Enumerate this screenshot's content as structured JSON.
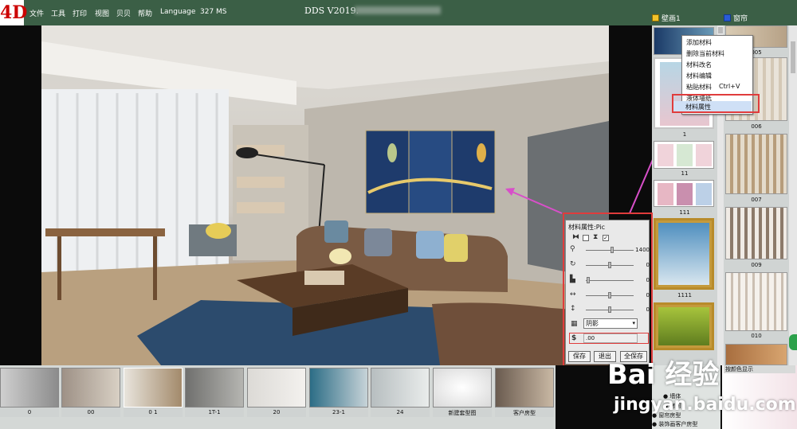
{
  "app": {
    "logo": "4D",
    "title": "DDS   V2019.",
    "menu": [
      "文件",
      "工具",
      "打印",
      "视图",
      "贝贝",
      "帮助",
      "Language",
      "327 MS"
    ],
    "window_tabs": [
      {
        "label": "壁画1",
        "icon": "picture-icon"
      },
      {
        "label": "窗帘",
        "icon": "home-icon"
      }
    ],
    "accent_colors": {
      "menubar": "#3b5f46",
      "highlight_box": "#e03c3c",
      "arrow": "#d84fc9"
    }
  },
  "context_menu": {
    "items": [
      "添加材料",
      "删除当前材料",
      "材料改名",
      "材料编辑",
      "粘贴材料",
      "液体墙纸",
      "材料属性"
    ],
    "paste_shortcut": "Ctrl+V",
    "selected": "材料属性"
  },
  "library_left": {
    "labels": [
      "1",
      "11",
      "111",
      "1111"
    ]
  },
  "library_right": {
    "labels": [
      "005",
      "006",
      "007",
      "009",
      "010"
    ]
  },
  "property_dialog": {
    "title": "材料属性:Pic",
    "checkbox_checked": true,
    "sliders": [
      {
        "name": "zoom",
        "icon": "zoom-icon",
        "value": "1400",
        "level": 0.55
      },
      {
        "name": "rotate",
        "icon": "rotate-icon",
        "value": "0",
        "level": 0.5
      },
      {
        "name": "shade",
        "icon": "shade-icon",
        "value": "0",
        "level": 0.02
      },
      {
        "name": "horizontal",
        "icon": "horizontal-arrows-icon",
        "value": "0",
        "level": 0.5
      },
      {
        "name": "vertical",
        "icon": "vertical-arrows-icon",
        "value": "0",
        "level": 0.5
      }
    ],
    "shadow_select": "阴影",
    "offset_value": ".00",
    "buttons": [
      "保存",
      "退出",
      "全保存"
    ]
  },
  "bottom_thumbnails": [
    "0",
    "00",
    "0 1",
    "1T-1",
    "20",
    "23-1",
    "24",
    "新建套型图",
    "客户房型"
  ],
  "legend": {
    "header": "按颜色显示",
    "items": [
      "墙体",
      "房间",
      "窗帘房型",
      "装饰画客户房型"
    ]
  },
  "watermark": {
    "main": "Bai 经验",
    "sub": "jingyan.baidu.com"
  }
}
